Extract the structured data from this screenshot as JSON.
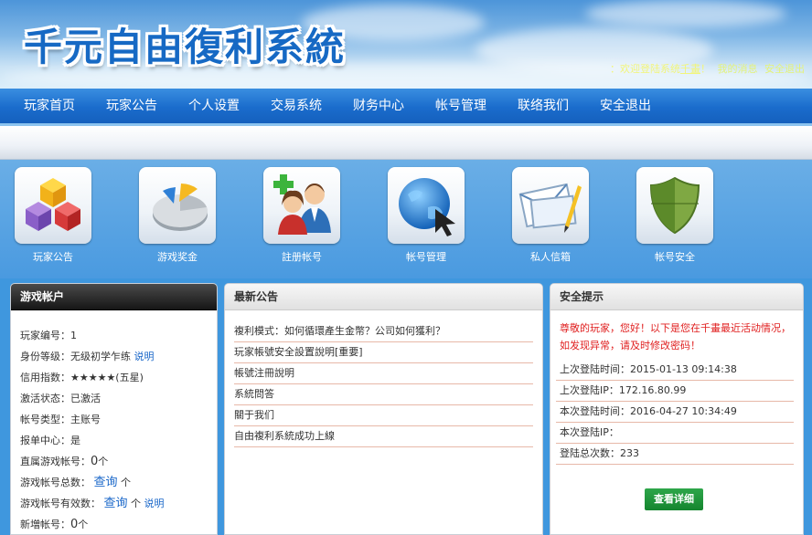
{
  "header": {
    "logo_text": "千元自由復利系統",
    "greeting_prefix": "：欢迎登陆系统",
    "username": "千畫",
    "greeting_sep": "！",
    "my_messages": "我的消息",
    "logout": "安全退出"
  },
  "nav": {
    "items": [
      "玩家首页",
      "玩家公告",
      "个人设置",
      "交易系统",
      "财务中心",
      "帐号管理",
      "联络我们",
      "安全退出"
    ]
  },
  "shortcuts": [
    {
      "label": "玩家公告",
      "icon": "cubes-icon"
    },
    {
      "label": "游戏奖金",
      "icon": "pie-chart-icon"
    },
    {
      "label": "註册帐号",
      "icon": "users-add-icon"
    },
    {
      "label": "帐号管理",
      "icon": "globe-cursor-icon"
    },
    {
      "label": "私人信箱",
      "icon": "mail-icon"
    },
    {
      "label": "帐号安全",
      "icon": "shield-icon"
    }
  ],
  "account": {
    "title": "游戏帐户",
    "player_id_label": "玩家编号：",
    "player_id": "1",
    "level_label": "身份等级：",
    "level": "无级初学乍练",
    "level_link": "说明",
    "credit_label": "信用指数：",
    "credit": "★★★★★(五星)",
    "status_label": "激活状态：",
    "status": "已激活",
    "type_label": "帐号类型：",
    "type": "主账号",
    "report_center_label": "报单中心：",
    "report_center": "是",
    "sub_accounts_label": "直属游戏帐号：",
    "sub_accounts": "0",
    "unit": "个",
    "total_label": "游戏帐号总数：",
    "total_link": "查询",
    "valid_label": "游戏帐号有效数：",
    "valid_link": "查询",
    "valid_help": "说明",
    "new_label": "新増帐号：",
    "new_count": "0"
  },
  "news": {
    "title": "最新公告",
    "items": [
      "複利模式：如何循環產生金幣？公司如何獲利？",
      "玩家帳號安全設置說明[重要]",
      "帳號注冊說明",
      "系統問答",
      "關于我们",
      "自由複利系統成功上線"
    ]
  },
  "security": {
    "title": "安全提示",
    "warning": "尊敬的玩家，您好！以下是您在千畫最近活动情况，如发现异常，请及时修改密码！",
    "rows": [
      {
        "label": "上次登陆时间：",
        "value": "2015-01-13 09:14:38"
      },
      {
        "label": "上次登陆IP：",
        "value": "172.16.80.99"
      },
      {
        "label": "本次登陆时间：",
        "value": "2016-04-27 10:34:49"
      },
      {
        "label": "本次登陆IP：",
        "value": ""
      },
      {
        "label": "登陆总次数：",
        "value": "233"
      }
    ],
    "detail_button": "查看详细"
  }
}
